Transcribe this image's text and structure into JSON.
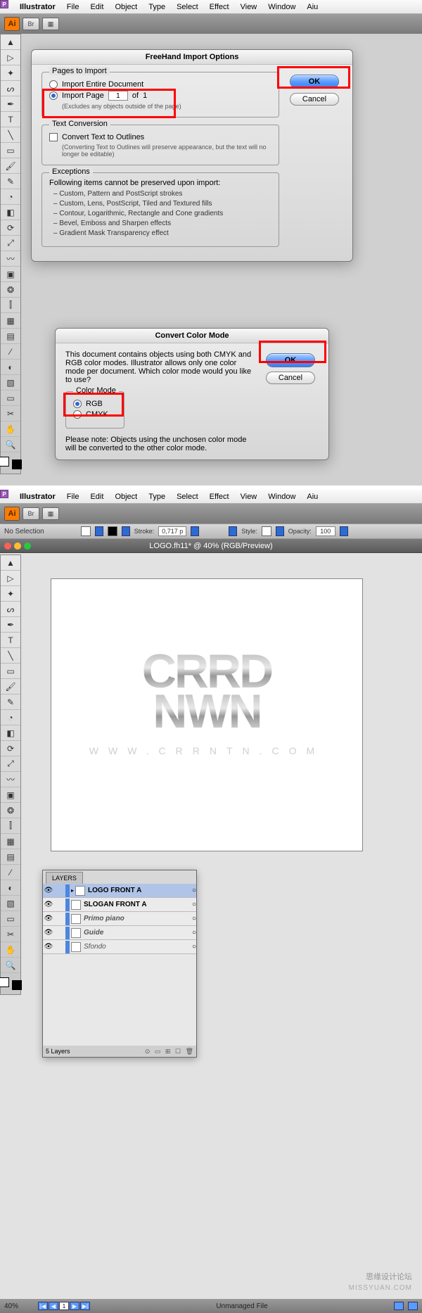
{
  "menu": {
    "app": "Illustrator",
    "items": [
      "File",
      "Edit",
      "Object",
      "Type",
      "Select",
      "Effect",
      "View",
      "Window",
      "Aiu"
    ]
  },
  "appbar": {
    "ai": "Ai",
    "br": "Br"
  },
  "dialog1": {
    "title": "FreeHand Import Options",
    "pages_legend": "Pages to Import",
    "import_entire": "Import Entire Document",
    "import_page": "Import Page",
    "page_num": "1",
    "of": "of",
    "total": "1",
    "excludes": "(Excludes any objects outside of the page)",
    "text_legend": "Text Conversion",
    "convert_text": "Convert Text to Outlines",
    "convert_hint": "(Converting Text to Outlines will preserve appearance, but the text will no longer be editable)",
    "exc_legend": "Exceptions",
    "exc_head": "Following items cannot be preserved upon import:",
    "exc_items": [
      "– Custom, Pattern and PostScript strokes",
      "– Custom, Lens, PostScript, Tiled and Textured fills",
      "– Contour, Logarithmic, Rectangle and Cone gradients",
      "– Bevel, Emboss and Sharpen effects",
      "– Gradient Mask Transparency effect"
    ],
    "ok": "OK",
    "cancel": "Cancel"
  },
  "dialog2": {
    "title": "Convert Color Mode",
    "msg": "This document contains objects using both CMYK and RGB color modes.  Illustrator allows only one color mode per document.  Which color mode would you like to use?",
    "cm_legend": "Color Mode",
    "rgb": "RGB",
    "cmyk": "CMYK",
    "note": "Please note: Objects using the unchosen color mode will be converted to the other color mode.",
    "ok": "OK",
    "cancel": "Cancel"
  },
  "control": {
    "nosel": "No Selection",
    "stroke_lbl": "Stroke:",
    "stroke_val": "0,717 p",
    "style_lbl": "Style:",
    "opacity_lbl": "Opacity:",
    "opacity_val": "100"
  },
  "doc": {
    "title": "LOGO.fh11* @ 40% (RGB/Preview)",
    "logo_l1": "CRRD",
    "logo_l2": "NWN",
    "logo_url": "WWW.CRRNTN.COM"
  },
  "layers": {
    "tab": "LAYERS",
    "rows": [
      {
        "name": "LOGO FRONT A",
        "sel": true
      },
      {
        "name": "SLOGAN FRONT A",
        "sel": false
      },
      {
        "name": "Primo piano",
        "sel": false
      },
      {
        "name": "Guide",
        "sel": false
      },
      {
        "name": "Sfondo",
        "sel": false
      }
    ],
    "count": "5 Layers"
  },
  "status": {
    "zoom": "40%",
    "file": "Unmanaged File"
  },
  "watermark": "MISSYUAN.COM",
  "watermark2": "思缘设计论坛"
}
